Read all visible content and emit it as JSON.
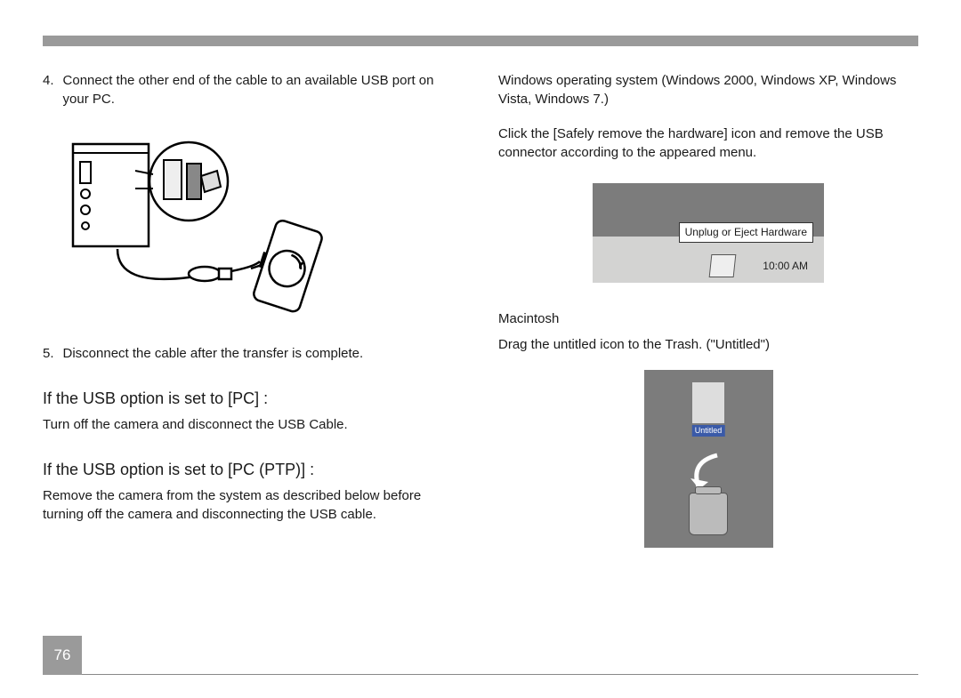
{
  "page_number": "76",
  "left": {
    "step4_num": "4.",
    "step4_text": "Connect the other end of the cable to an available USB port on your PC.",
    "step5_num": "5.",
    "step5_text": "Disconnect the cable after the transfer is complete.",
    "heading_pc": "If the USB option is set to [PC] :",
    "pc_body": "Turn off the camera and disconnect the USB Cable.",
    "heading_ptp": "If the USB option is set to [PC (PTP)] :",
    "ptp_body": "Remove the camera from the system as described below before turning off the camera and disconnecting the USB cable."
  },
  "right": {
    "win_title": "Windows operating system (Windows 2000, Windows XP, Windows Vista, Windows 7.)",
    "win_body": "Click the [Safely remove the hardware] icon and remove the USB connector according to the appeared menu.",
    "tray_tooltip": "Unplug or Eject Hardware",
    "tray_time": "10:00 AM",
    "mac_heading": "Macintosh",
    "mac_body": "Drag the untitled icon to the Trash. (\"Untitled\")",
    "mac_drive_label": "Untitled"
  },
  "icons": {
    "pc_connection": "pc-usb-cable-camera-illustration",
    "systray": "windows-system-tray-safely-remove",
    "mac_trash": "mac-drag-drive-to-trash"
  }
}
